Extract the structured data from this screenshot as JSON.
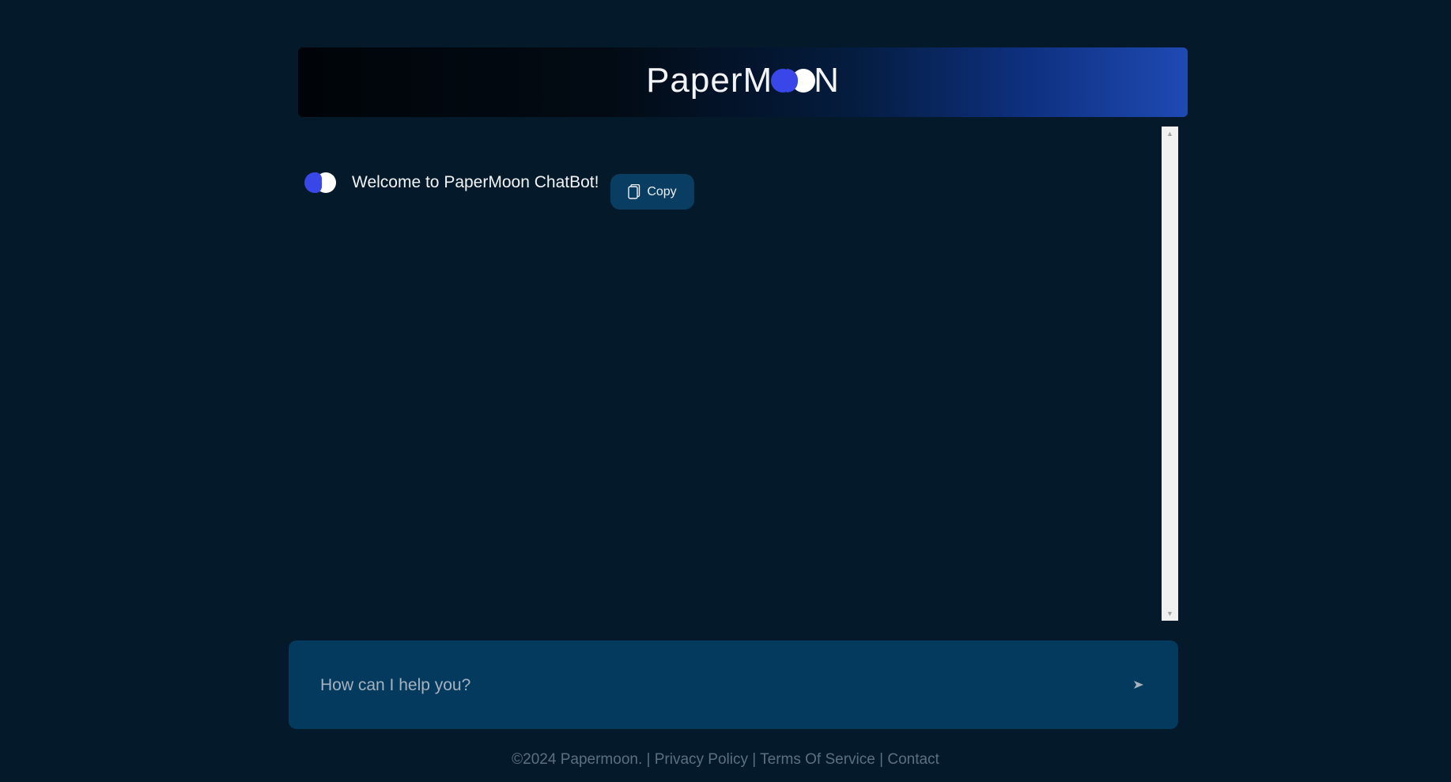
{
  "header": {
    "logo_prefix": "PaperM",
    "logo_suffix": "N"
  },
  "chat": {
    "messages": [
      {
        "text": "Welcome to PaperMoon ChatBot!",
        "copy_label": "Copy"
      }
    ]
  },
  "input": {
    "placeholder": "How can I help you?",
    "send_icon": "send-arrow-icon"
  },
  "footer": {
    "copyright": "©2024 Papermoon.",
    "separator": "|",
    "links": [
      "Privacy Policy",
      "Terms Of Service",
      "Contact"
    ]
  },
  "colors": {
    "background": "#041a2a",
    "accent_blue": "#3a47e8",
    "input_bg": "#053a5f",
    "copy_button_bg": "#0a3d62"
  }
}
